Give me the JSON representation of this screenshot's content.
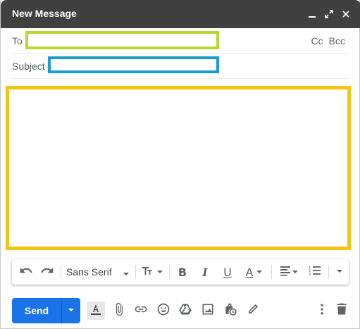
{
  "header": {
    "title": "New Message",
    "minimize_icon": "minimize-icon",
    "expand_icon": "expand-icon",
    "close_icon": "close-icon",
    "background_color": "#404040"
  },
  "recipients": {
    "to_label": "To",
    "to_value": "",
    "cc_label": "Cc",
    "bcc_label": "Bcc",
    "to_highlight_color": "#b6d936"
  },
  "subject": {
    "label": "Subject",
    "value": "",
    "highlight_color": "#1a9bd7"
  },
  "message_body": {
    "value": "",
    "highlight_color": "#f2c511"
  },
  "format_toolbar": {
    "font_family": "Sans Serif",
    "bold_label": "B",
    "italic_label": "I",
    "underline_label": "U",
    "text_color_label": "A",
    "icons": [
      "undo-icon",
      "redo-icon",
      "font-size-icon",
      "align-icon",
      "numbered-list-icon",
      "more-formatting-icon"
    ]
  },
  "bottom_bar": {
    "send_label": "Send",
    "accent_color": "#1a73e8",
    "icons": [
      "formatting-options-icon",
      "attach-icon",
      "link-icon",
      "emoji-icon",
      "drive-icon",
      "photo-icon",
      "confidential-mode-icon",
      "signature-icon",
      "more-options-icon",
      "discard-icon"
    ]
  }
}
